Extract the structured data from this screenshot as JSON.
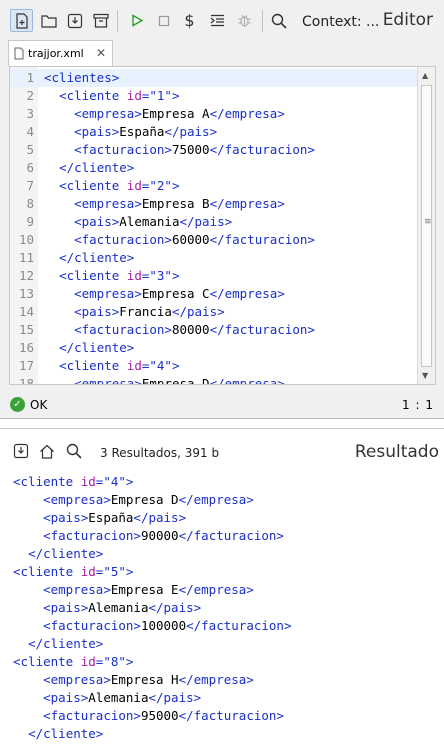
{
  "editor": {
    "context_label": "Context: ...",
    "panel_title": "Editor",
    "tab": {
      "label": "trajjor.xml"
    },
    "status_text": "OK",
    "cursor_position": "1 : 1",
    "line_numbers": [
      "1",
      "2",
      "3",
      "4",
      "5",
      "6",
      "7",
      "8",
      "9",
      "10",
      "11",
      "12",
      "13",
      "14",
      "15",
      "16",
      "17",
      "18"
    ],
    "lines": [
      {
        "indent": "",
        "tag": "<clientes>",
        "attr": "",
        "val": "",
        "close": "",
        "text": "",
        "end": ""
      },
      {
        "indent": "  ",
        "tag": "<cliente ",
        "attr": "id",
        "val": "=\"1\">",
        "close": "",
        "text": "",
        "end": ""
      },
      {
        "indent": "    ",
        "tag": "<empresa>",
        "attr": "",
        "val": "",
        "close": "",
        "text": "Empresa A",
        "end": "</empresa>"
      },
      {
        "indent": "    ",
        "tag": "<pais>",
        "attr": "",
        "val": "",
        "close": "",
        "text": "España",
        "end": "</pais>"
      },
      {
        "indent": "    ",
        "tag": "<facturacion>",
        "attr": "",
        "val": "",
        "close": "",
        "text": "75000",
        "end": "</facturacion>"
      },
      {
        "indent": "  ",
        "tag": "</cliente>",
        "attr": "",
        "val": "",
        "close": "",
        "text": "",
        "end": ""
      },
      {
        "indent": "  ",
        "tag": "<cliente ",
        "attr": "id",
        "val": "=\"2\">",
        "close": "",
        "text": "",
        "end": ""
      },
      {
        "indent": "    ",
        "tag": "<empresa>",
        "attr": "",
        "val": "",
        "close": "",
        "text": "Empresa B",
        "end": "</empresa>"
      },
      {
        "indent": "    ",
        "tag": "<pais>",
        "attr": "",
        "val": "",
        "close": "",
        "text": "Alemania",
        "end": "</pais>"
      },
      {
        "indent": "    ",
        "tag": "<facturacion>",
        "attr": "",
        "val": "",
        "close": "",
        "text": "60000",
        "end": "</facturacion>"
      },
      {
        "indent": "  ",
        "tag": "</cliente>",
        "attr": "",
        "val": "",
        "close": "",
        "text": "",
        "end": ""
      },
      {
        "indent": "  ",
        "tag": "<cliente ",
        "attr": "id",
        "val": "=\"3\">",
        "close": "",
        "text": "",
        "end": ""
      },
      {
        "indent": "    ",
        "tag": "<empresa>",
        "attr": "",
        "val": "",
        "close": "",
        "text": "Empresa C",
        "end": "</empresa>"
      },
      {
        "indent": "    ",
        "tag": "<pais>",
        "attr": "",
        "val": "",
        "close": "",
        "text": "Francia",
        "end": "</pais>"
      },
      {
        "indent": "    ",
        "tag": "<facturacion>",
        "attr": "",
        "val": "",
        "close": "",
        "text": "80000",
        "end": "</facturacion>"
      },
      {
        "indent": "  ",
        "tag": "</cliente>",
        "attr": "",
        "val": "",
        "close": "",
        "text": "",
        "end": ""
      },
      {
        "indent": "  ",
        "tag": "<cliente ",
        "attr": "id",
        "val": "=\"4\">",
        "close": "",
        "text": "",
        "end": ""
      },
      {
        "indent": "    ",
        "tag": "<empresa>",
        "attr": "",
        "val": "",
        "close": "",
        "text": "Empresa D",
        "end": "</empresa>"
      }
    ],
    "icons": [
      "new-file-icon",
      "open-folder-icon",
      "save-icon",
      "archive-icon",
      "run-icon",
      "stop-icon",
      "dollar-icon",
      "indent-icon",
      "bug-icon",
      "search-icon"
    ]
  },
  "result": {
    "count_label": "3 Resultados, 391 b",
    "panel_title": "Resultado",
    "lines": [
      {
        "indent": "",
        "tag": "<cliente ",
        "attr": "id",
        "val": "=\"4\">",
        "text": "",
        "end": ""
      },
      {
        "indent": "    ",
        "tag": "<empresa>",
        "attr": "",
        "val": "",
        "text": "Empresa D",
        "end": "</empresa>"
      },
      {
        "indent": "    ",
        "tag": "<pais>",
        "attr": "",
        "val": "",
        "text": "España",
        "end": "</pais>"
      },
      {
        "indent": "    ",
        "tag": "<facturacion>",
        "attr": "",
        "val": "",
        "text": "90000",
        "end": "</facturacion>"
      },
      {
        "indent": "  ",
        "tag": "</cliente>",
        "attr": "",
        "val": "",
        "text": "",
        "end": ""
      },
      {
        "indent": "",
        "tag": "<cliente ",
        "attr": "id",
        "val": "=\"5\">",
        "text": "",
        "end": ""
      },
      {
        "indent": "    ",
        "tag": "<empresa>",
        "attr": "",
        "val": "",
        "text": "Empresa E",
        "end": "</empresa>"
      },
      {
        "indent": "    ",
        "tag": "<pais>",
        "attr": "",
        "val": "",
        "text": "Alemania",
        "end": "</pais>"
      },
      {
        "indent": "    ",
        "tag": "<facturacion>",
        "attr": "",
        "val": "",
        "text": "100000",
        "end": "</facturacion>"
      },
      {
        "indent": "  ",
        "tag": "</cliente>",
        "attr": "",
        "val": "",
        "text": "",
        "end": ""
      },
      {
        "indent": "",
        "tag": "<cliente ",
        "attr": "id",
        "val": "=\"8\">",
        "text": "",
        "end": ""
      },
      {
        "indent": "    ",
        "tag": "<empresa>",
        "attr": "",
        "val": "",
        "text": "Empresa H",
        "end": "</empresa>"
      },
      {
        "indent": "    ",
        "tag": "<pais>",
        "attr": "",
        "val": "",
        "text": "Alemania",
        "end": "</pais>"
      },
      {
        "indent": "    ",
        "tag": "<facturacion>",
        "attr": "",
        "val": "",
        "text": "95000",
        "end": "</facturacion>"
      },
      {
        "indent": "  ",
        "tag": "</cliente>",
        "attr": "",
        "val": "",
        "text": "",
        "end": ""
      }
    ],
    "icons": [
      "export-icon",
      "home-icon",
      "search-icon"
    ]
  },
  "colors": {
    "tag": "#1a2fc9",
    "attr": "#a31fa3",
    "ok": "#3aa23a",
    "current_line": "#e8f2fe"
  }
}
